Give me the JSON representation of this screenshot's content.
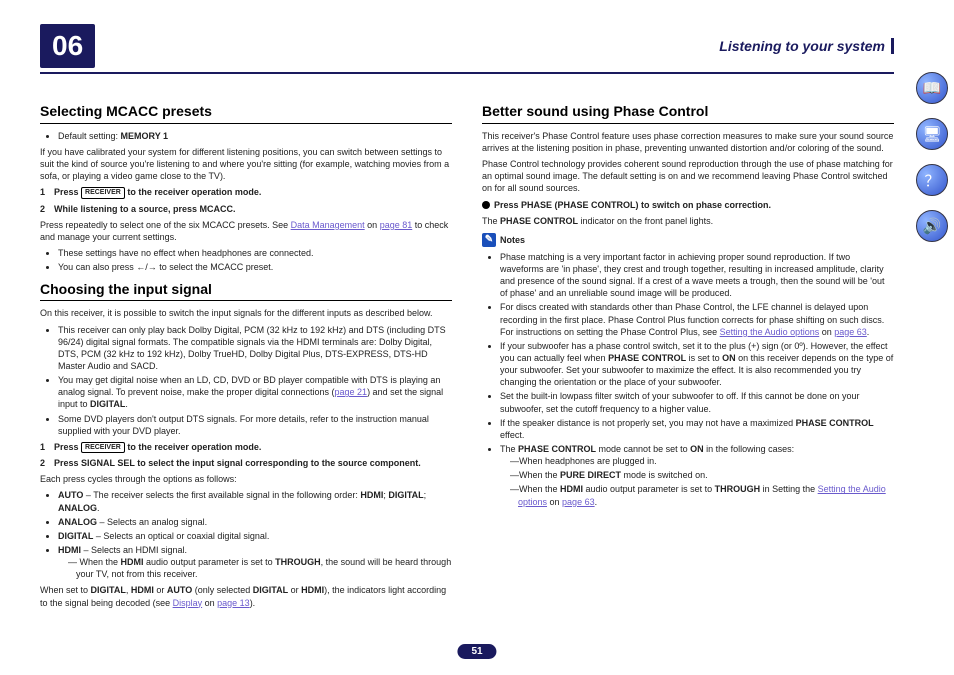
{
  "chapter": "06",
  "headerRight": "Listening to your system",
  "pageNumber": "51",
  "col1": {
    "s1": {
      "title": "Selecting MCACC presets",
      "defaultSetting": "MEMORY 1",
      "intro": "If you have calibrated your system for different listening positions, you can switch between settings to suit the kind of source you're listening to and where you're sitting (for example, watching movies from a sofa, or playing a video game close to the TV).",
      "step1_num": "1",
      "step1_pre": "Press ",
      "step1_key": "RECEIVER",
      "step1_post": " to the receiver operation mode.",
      "step2_num": "2",
      "step2_txt": "While listening to a source, press MCACC.",
      "p_after_a": "Press repeatedly to select one of the six MCACC presets. See ",
      "p_after_link": "Data Management",
      "p_after_b": " on ",
      "p_after_link2": "page 81",
      "p_after_c": " to check and manage your current settings.",
      "b1": "These settings have no effect when headphones are connected.",
      "b2_pre": "You can also press ",
      "b2_post": " to select the MCACC preset."
    },
    "s2": {
      "title": "Choosing the input signal",
      "intro": "On this receiver, it is possible to switch the input signals for the different inputs as described below.",
      "b1": "This receiver can only play back Dolby Digital, PCM (32 kHz to 192 kHz) and DTS (including DTS 96/24) digital signal formats. The compatible signals via the HDMI terminals are: Dolby Digital, DTS, PCM (32 kHz to 192 kHz), Dolby TrueHD, Dolby Digital Plus, DTS-EXPRESS, DTS-HD Master Audio and SACD.",
      "b2_pre": "You may get digital noise when an LD, CD, DVD or BD player compatible with DTS is playing an analog signal. To prevent noise, make the proper digital connections (",
      "b2_link": "page 21",
      "b2_post_a": ") and set the signal input to ",
      "b2_post_b": ".",
      "word_digital": "DIGITAL",
      "b3": "Some DVD players don't output DTS signals. For more details, refer to the instruction manual supplied with your DVD player.",
      "step1_num": "1",
      "step1_pre": "Press ",
      "step1_key": "RECEIVER",
      "step1_post": " to the receiver operation mode.",
      "step2_num": "2",
      "step2_txt": "Press SIGNAL SEL to select the input signal corresponding to the source component.",
      "p_cycles": "Each press cycles through the options as follows:",
      "sb_auto_pre": " – The receiver selects the first available signal in the following order: ",
      "lab_auto": "AUTO",
      "lab_hdmi": "HDMI",
      "lab_digital": "DIGITAL",
      "lab_analog": "ANALOG",
      "sb_analog": " – Selects an analog signal.",
      "sb_digital": " – Selects an optical or coaxial digital signal.",
      "sb_hdmi": " – Selects an HDMI signal.",
      "sub_hdmi_pre": " When the ",
      "sub_hdmi_mid": " audio output parameter is set to ",
      "word_through": "THROUGH",
      "sub_hdmi_post": ", the sound will be heard through your TV, not from this receiver.",
      "p_end_a": "When set to ",
      "p_end_b": " or ",
      "p_end_c": " (only selected ",
      "p_end_d": "), the indicators light according to the signal being decoded (see ",
      "p_end_link": "Display",
      "p_end_e": " on ",
      "p_end_link2": "page 13",
      "p_end_f": ")."
    }
  },
  "col2": {
    "s3": {
      "title": "Better sound using Phase Control",
      "p1": "This receiver's Phase Control feature uses phase correction measures to make sure your sound source arrives at the listening position in phase, preventing unwanted distortion and/or coloring of the sound.",
      "p2": "Phase Control technology provides coherent sound reproduction through the use of phase matching for an optimal sound image. The default setting is on and we recommend leaving Phase Control switched on for all sound sources.",
      "act_txt": "Press PHASE (PHASE CONTROL) to switch on phase correction.",
      "p3_a": "The ",
      "word_pc": "PHASE CONTROL",
      "p3_b": " indicator on the front panel lights.",
      "notes_label": "Notes",
      "n1": "Phase matching is a very important factor in achieving proper sound reproduction. If two waveforms are 'in phase', they crest and trough together, resulting in increased amplitude, clarity and presence of the sound signal. If a crest of a wave meets a trough, then the sound will be 'out of phase' and an unreliable sound image will be produced.",
      "n2_a": "For discs created with standards other than Phase Control, the LFE channel is delayed upon recording in the first place. Phase Control Plus function corrects for phase shifting on such discs. For instructions on setting the Phase Control Plus, see ",
      "n2_link": "Setting the Audio options",
      "n2_b": " on ",
      "n2_link2": "page 63",
      "n2_c": ".",
      "n3_a": "If your subwoofer has a phase control switch, set it to the plus (+) sign (or 0º). However, the effect you can actually feel when ",
      "n3_b": " is set to ",
      "word_on": "ON",
      "n3_c": " on this receiver depends on the type of your subwoofer. Set your subwoofer to maximize the effect. It is also recommended you try changing the orientation or the place of your subwoofer.",
      "n4": "Set the built-in lowpass filter switch of your subwoofer to off. If this cannot be done on your subwoofer, set the cutoff frequency to a higher value.",
      "n5_a": "If the speaker distance is not properly set, you may not have a maximized ",
      "n5_b": " effect.",
      "n6_a": "The ",
      "n6_b": " mode cannot be set to ",
      "n6_c": " in the following cases:",
      "n6_s1": "When headphones are plugged in.",
      "n6_s2_a": "When the ",
      "word_pd": "PURE DIRECT",
      "n6_s2_b": " mode is switched on.",
      "n6_s3_a": "When the ",
      "n6_s3_b": " audio output parameter is set to ",
      "n6_s3_c": " in Setting the ",
      "n6_s3_link": "Setting the Audio options",
      "n6_s3_d": " on ",
      "n6_s3_link2": "page 63",
      "n6_s3_e": ".",
      "word_hdmi": "HDMI"
    }
  },
  "sidebar_icons": [
    "book",
    "screen",
    "faq",
    "units"
  ]
}
